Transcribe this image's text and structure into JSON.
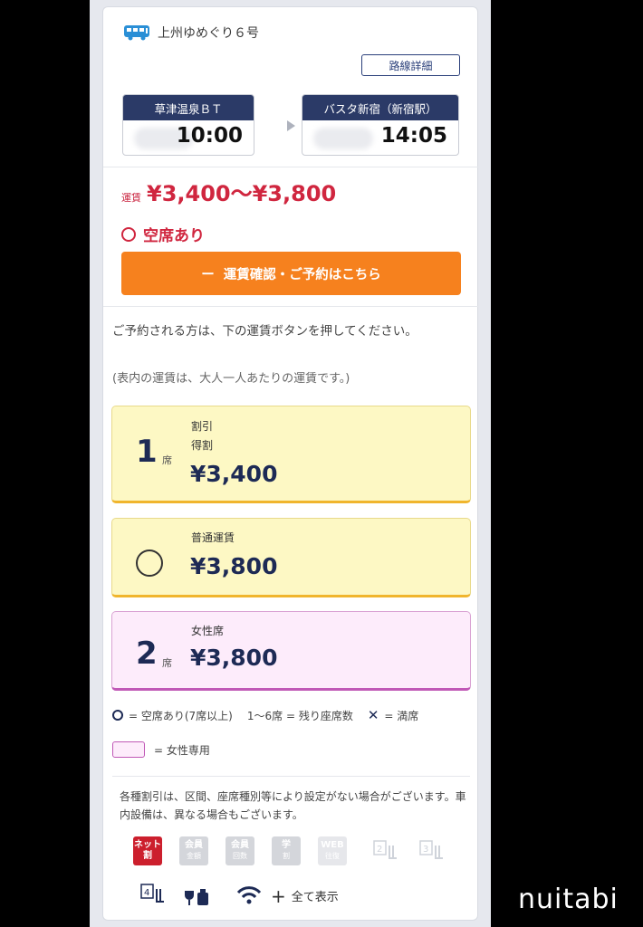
{
  "bus": {
    "icon": "bus-icon",
    "name": "上州ゆめぐり６号"
  },
  "route_detail_label": "路線詳細",
  "departure": {
    "stop": "草津温泉ＢＴ",
    "time": "10:00"
  },
  "arrival": {
    "stop": "バスタ新宿（新宿駅）",
    "time": "14:05"
  },
  "fare": {
    "label": "運賃",
    "range": "¥3,400〜¥3,800"
  },
  "vacancy": {
    "text": "空席あり"
  },
  "booking_button": {
    "prefix": "ー",
    "label": "運賃確認・ご予約はこちら"
  },
  "instructions": {
    "line": "ご予約される方は、下の運賃ボタンを押してください。",
    "sub": "(表内の運賃は、大人一人あたりの運賃です。)"
  },
  "fares": [
    {
      "availability": "1",
      "seat_unit": "席",
      "types": [
        "割引",
        "得割"
      ],
      "price": "¥3,400"
    },
    {
      "availability": "circle",
      "types": [
        "普通運賃"
      ],
      "price": "¥3,800"
    },
    {
      "availability": "2",
      "seat_unit": "席",
      "types": [
        "女性席"
      ],
      "price": "¥3,800"
    }
  ],
  "legend": {
    "available": "= 空席あり(7席以上)",
    "remaining": "1〜6席 = 残り座席数",
    "full_mark": "✕",
    "full": "= 満席",
    "women_only": "= 女性専用"
  },
  "footnote": "各種割引は、区間、座席種別等により設定がない場合がございます。車内設備は、異なる場合もございます。",
  "amenities": [
    {
      "icon": "net-discount-icon",
      "top": "ネット",
      "bottom": "割"
    },
    {
      "icon": "member-amount-icon",
      "top": "会員",
      "bottom": "金額"
    },
    {
      "icon": "member-count-icon",
      "top": "会員",
      "bottom": "回数"
    },
    {
      "icon": "student-discount-icon",
      "top": "学",
      "bottom": "割"
    },
    {
      "icon": "web-round-trip-icon",
      "top": "WEB",
      "bottom": "往復"
    }
  ],
  "seat_icons": [
    "2",
    "3",
    "4"
  ],
  "show_all_label": "全て表示",
  "watermark": "nuitabi",
  "colors": {
    "navy": "#2b3a67",
    "orange": "#f6811e",
    "red": "#d0263f",
    "yellow": "#fdf8c4",
    "pink": "#fdecfb"
  }
}
